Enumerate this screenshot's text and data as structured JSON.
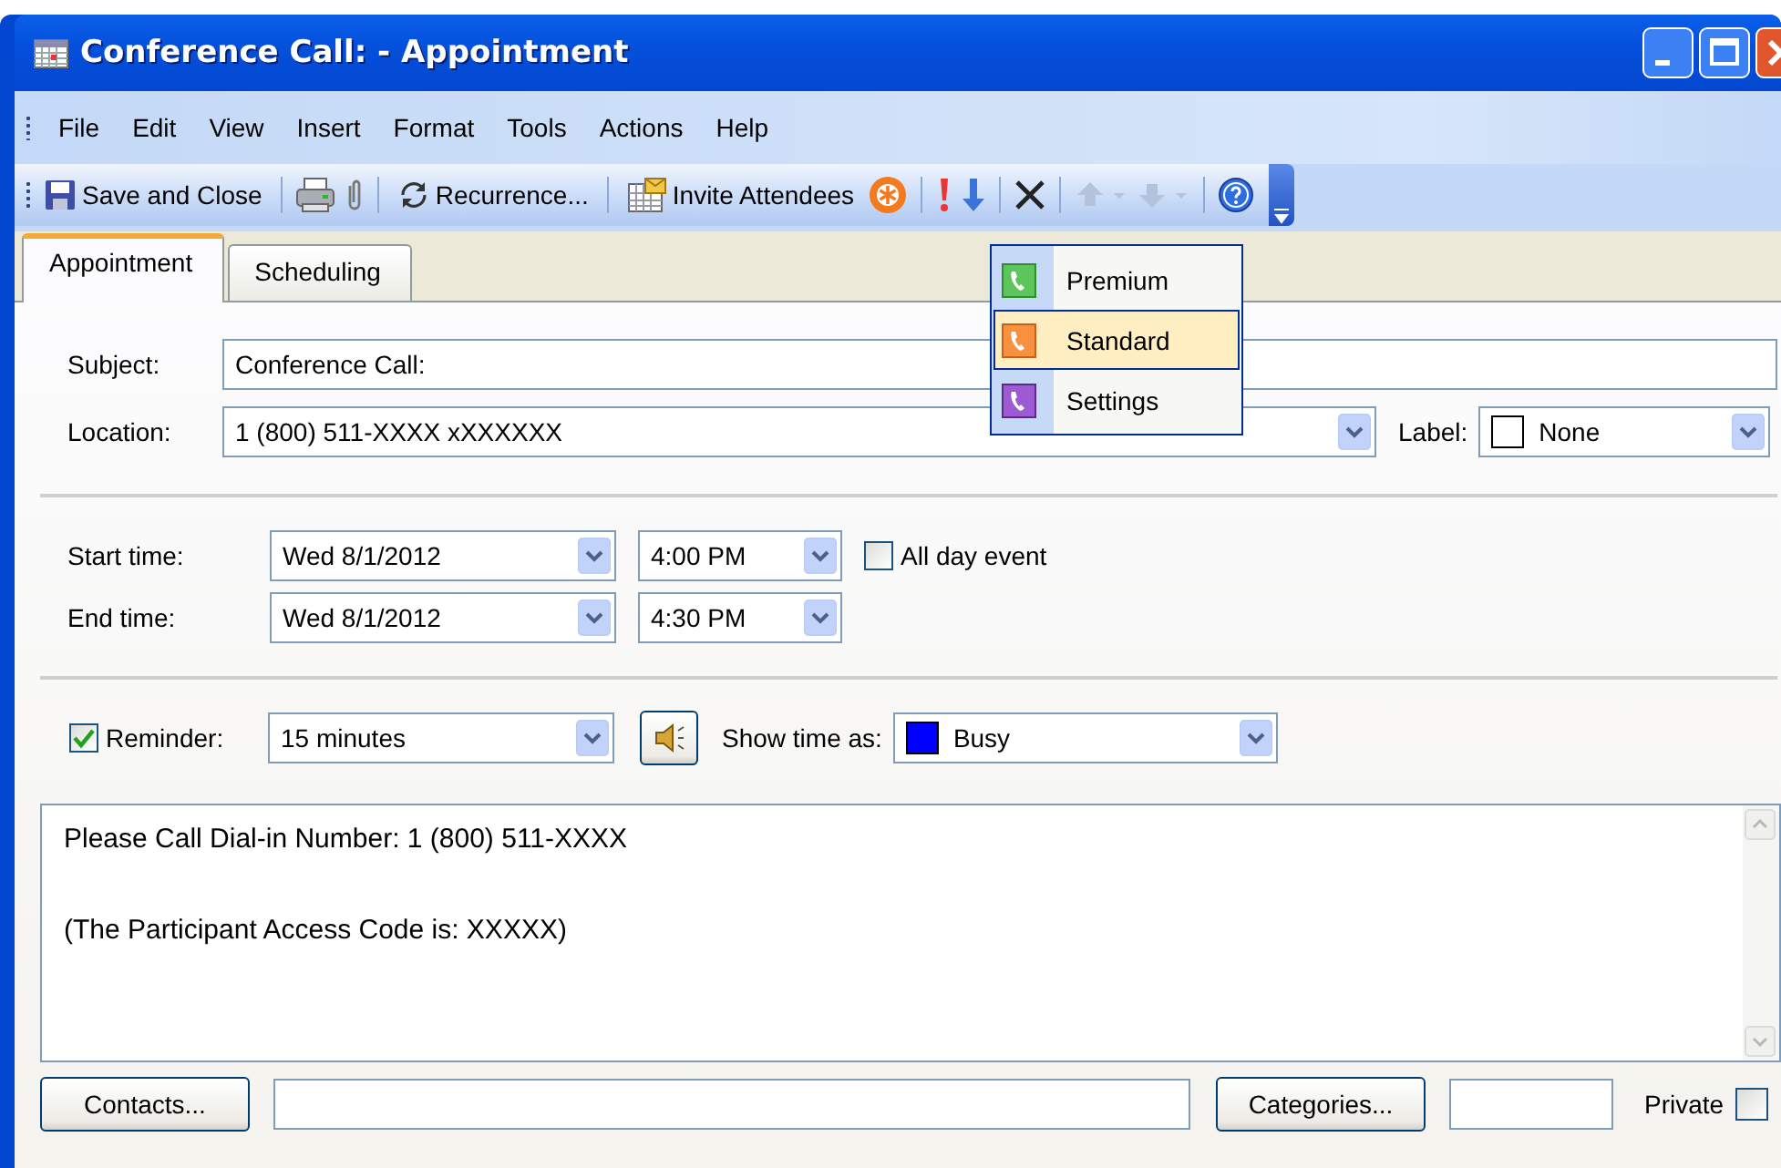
{
  "window": {
    "title": "Conference Call:  - Appointment"
  },
  "menu": [
    "File",
    "Edit",
    "View",
    "Insert",
    "Format",
    "Tools",
    "Actions",
    "Help"
  ],
  "toolbar": {
    "save_label": "Save and Close",
    "recurrence_label": "Recurrence...",
    "invite_label": "Invite Attendees",
    "previous_item": {
      "disabled": true
    },
    "next_item": {
      "disabled": true
    }
  },
  "tabs": [
    {
      "label": "Appointment",
      "selected": true
    },
    {
      "label": "Scheduling",
      "selected": false
    }
  ],
  "subject": {
    "label": "Subject:",
    "value": "Conference Call:"
  },
  "location": {
    "label": "Location:",
    "value": "1 (800) 511-XXXX xXXXXXX"
  },
  "label_field": {
    "label": "Label:",
    "value": "None",
    "color": "#ffffff"
  },
  "start": {
    "label": "Start time:",
    "date": "Wed 8/1/2012",
    "time": "4:00 PM"
  },
  "all_day": {
    "label": "All day event",
    "checked": false
  },
  "end": {
    "label": "End time:",
    "date": "Wed 8/1/2012",
    "time": "4:30 PM"
  },
  "reminder": {
    "label": "Reminder:",
    "checked": true,
    "value": "15 minutes"
  },
  "show_time_as": {
    "label": "Show time as:",
    "value": "Busy",
    "color": "#0000ff"
  },
  "notes": [
    "Please Call Dial-in Number: 1 (800) 511-XXXX",
    "(The Participant Access Code is: XXXXX)"
  ],
  "footer": {
    "contacts_button": "Contacts...",
    "categories_button": "Categories...",
    "private": {
      "label": "Private",
      "checked": false
    }
  },
  "popup": [
    {
      "label": "Premium",
      "selected": false
    },
    {
      "label": "Standard",
      "selected": true
    },
    {
      "label": "Settings",
      "selected": false
    }
  ]
}
